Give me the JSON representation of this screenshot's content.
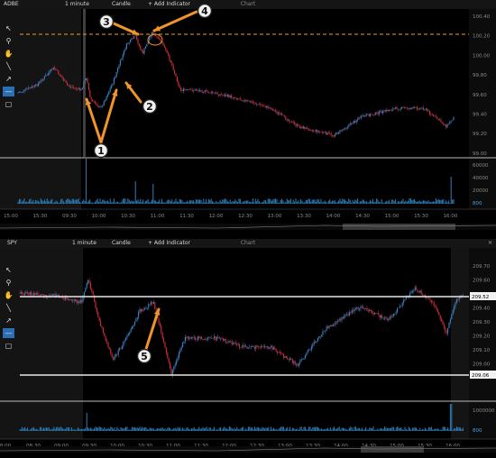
{
  "panels": [
    {
      "symbol": "ADBE",
      "interval": "1 minute",
      "style": "Candle",
      "add_indicator": "+ Add Indicator",
      "title": "Chart",
      "price_ticks": [
        "100.40",
        "100.20",
        "100.00",
        "99.80",
        "99.60",
        "99.40",
        "99.20",
        "99.00"
      ],
      "volume_ticks": [
        "60000",
        "40000",
        "20000",
        "800"
      ],
      "time_ticks": [
        "15:00",
        "15:30",
        "09:30",
        "10:00",
        "10:30",
        "11:00",
        "11:30",
        "12:00",
        "12:30",
        "13:00",
        "13:30",
        "14:00",
        "14:30",
        "15:00",
        "15:30",
        "16:00"
      ],
      "annotations": [
        "1",
        "2",
        "3",
        "4"
      ]
    },
    {
      "symbol": "SPY",
      "interval": "1 minute",
      "style": "Candle",
      "add_indicator": "+ Add Indicator",
      "title": "Chart",
      "price_ticks": [
        "209.70",
        "209.60",
        "209.50",
        "209.40",
        "209.30",
        "209.20",
        "209.10",
        "209.00"
      ],
      "level_labels": [
        "209.52",
        "209.06"
      ],
      "volume_ticks": [
        "1000000",
        "800"
      ],
      "time_ticks": [
        "8:00",
        "08:30",
        "09:00",
        "09:30",
        "10:00",
        "10:30",
        "11:00",
        "11:30",
        "12:00",
        "12:30",
        "13:00",
        "13:30",
        "14:00",
        "14:30",
        "15:00",
        "15:30",
        "16:00"
      ],
      "annotations": [
        "5"
      ]
    }
  ],
  "tools": [
    "pointer-icon",
    "zoom-icon",
    "hand-icon",
    "line-icon",
    "arrow-icon",
    "horizontal-line-icon",
    "rectangle-icon"
  ],
  "colors": {
    "up": "#3a86c8",
    "down": "#d0303a",
    "accent": "#f0952a",
    "dashed": "#f0a020",
    "level": "#e8e8e8",
    "volume": "#2e7fb8"
  }
}
